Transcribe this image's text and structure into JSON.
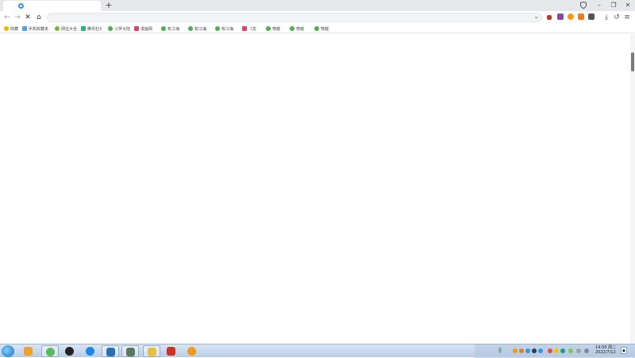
{
  "browser": {
    "new_tab_symbol": "+",
    "window": {
      "minimize": "–",
      "restore": "❐",
      "close": "✕"
    },
    "nav": {
      "back": "←",
      "forward": "→",
      "stop": "✕",
      "home": "⌂"
    },
    "toolbar_icons": {
      "download": "⤓",
      "undo": "↺",
      "menu": "≡"
    },
    "address_dropdown": "⌄"
  },
  "bookmarks": [
    {
      "label": "收藏",
      "icon": "star-icon",
      "color": "#f5b400"
    },
    {
      "label": "手机收藏夹",
      "icon": "phone-icon",
      "color": "#5aa0e6"
    },
    {
      "label": "网址大全",
      "icon": "globe-icon",
      "color": "#7cb342"
    },
    {
      "label": "腾讯社3",
      "icon": "app-icon",
      "color": "#22b573"
    },
    {
      "label": "斗罗大陆",
      "icon": "play-icon",
      "color": "#4caf50"
    },
    {
      "label": "漫画网",
      "icon": "book-icon",
      "color": "#e0407a"
    },
    {
      "label": "有江海",
      "icon": "play-icon",
      "color": "#4caf50"
    },
    {
      "label": "有江海",
      "icon": "play-icon",
      "color": "#4caf50"
    },
    {
      "label": "有江海",
      "icon": "play-icon",
      "color": "#4caf50"
    },
    {
      "label": "《龙",
      "icon": "book-icon",
      "color": "#e0407a"
    },
    {
      "label": "穿越",
      "icon": "play-icon",
      "color": "#4caf50"
    },
    {
      "label": "穿越",
      "icon": "play-icon",
      "color": "#4caf50"
    },
    {
      "label": "穿越",
      "icon": "play-icon",
      "color": "#4caf50"
    }
  ],
  "taskbar": {
    "apps": [
      {
        "name": "folder-app",
        "color": "#f0a030"
      },
      {
        "name": "browser-app",
        "color": "#5cb85c"
      },
      {
        "name": "obs-app",
        "color": "#222222"
      },
      {
        "name": "swirl-app",
        "color": "#1e88e5"
      },
      {
        "name": "blue-app",
        "color": "#2a6fb5"
      },
      {
        "name": "game-app",
        "color": "#5a7a60"
      },
      {
        "name": "glasses-app",
        "color": "#e8c040"
      },
      {
        "name": "character-app",
        "color": "#cc3322"
      },
      {
        "name": "help-app",
        "color": "#f29a1e"
      }
    ],
    "clock": {
      "time": "14:00 周二",
      "date": "2022/7/12"
    },
    "tray_colors": [
      "#f39c12",
      "#e67e22",
      "#3498db",
      "#2c3e50",
      "#3498db",
      "#e74c3c",
      "#f1c40f",
      "#16a085",
      "#8bc34a",
      "#95a5a6"
    ]
  }
}
